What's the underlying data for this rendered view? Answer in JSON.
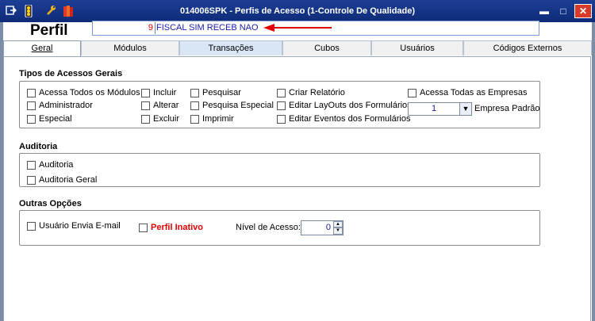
{
  "window": {
    "title": "014006SPK - Perfis de Acesso (1-Controle De Qualidade)",
    "minimize": "▬",
    "maximize": "□",
    "close": "✕"
  },
  "toolbar": {
    "icons": [
      "menu-icon",
      "traffic-light-icon",
      "wrench-icon",
      "books-icon"
    ]
  },
  "header": {
    "label": "Perfil",
    "profile_number": "9",
    "profile_name": "FISCAL SIM RECEB NAO"
  },
  "tabs": [
    {
      "label": "Geral",
      "active": true
    },
    {
      "label": "Módulos"
    },
    {
      "label": "Transações"
    },
    {
      "label": "Cubos"
    },
    {
      "label": "Usuários"
    },
    {
      "label": "Códigos Externos"
    }
  ],
  "sections": {
    "tipos": {
      "title": "Tipos de Acessos Gerais",
      "acessa_todos_modulos": "Acessa Todos os Módulos",
      "administrador": "Administrador",
      "especial": "Especial",
      "incluir": "Incluir",
      "alterar": "Alterar",
      "excluir": "Excluir",
      "pesquisar": "Pesquisar",
      "pesquisa_especial": "Pesquisa Especial",
      "imprimir": "Imprimir",
      "criar_relatorio": "Criar Relatório",
      "editar_layouts": "Editar LayOuts dos Formulários",
      "editar_eventos": "Editar Eventos dos Formulários",
      "acessa_todas_empresas": "Acessa Todas as Empresas",
      "empresa_padrao_value": "1",
      "empresa_padrao_label": "Empresa Padrão"
    },
    "auditoria": {
      "title": "Auditoria",
      "auditoria": "Auditoria",
      "auditoria_geral": "Auditoria Geral"
    },
    "outras": {
      "title": "Outras Opções",
      "usuario_envia_email": "Usuário Envia E-mail",
      "perfil_inativo": "Perfil Inativo",
      "nivel_acesso_label": "Nível de Acesso:",
      "nivel_acesso_value": "0"
    }
  },
  "colors": {
    "titlebar": "#1c3f95",
    "arrow": "#e00000",
    "profile_name": "#1a1aa8"
  }
}
